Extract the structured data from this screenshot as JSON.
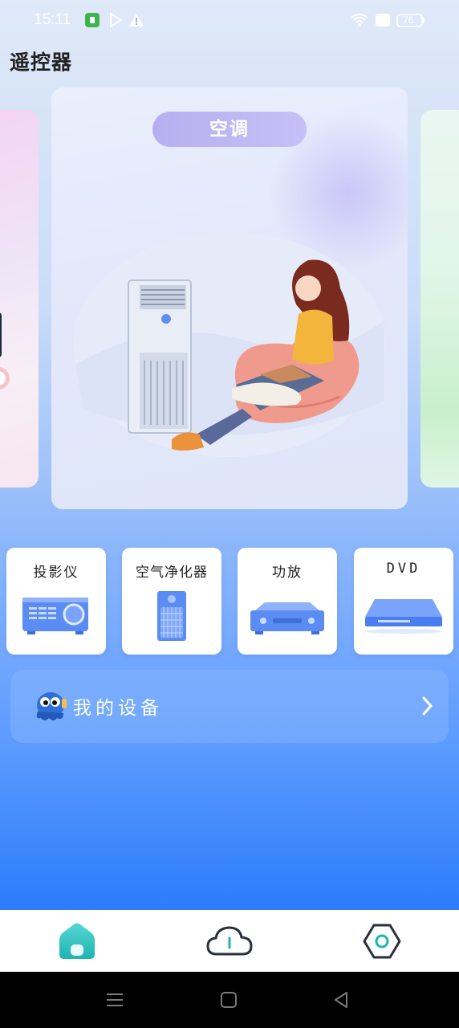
{
  "status_bar": {
    "time": "15:11",
    "battery": "76"
  },
  "header": {
    "title": "遥控器"
  },
  "featured": {
    "title": "空调"
  },
  "devices": [
    {
      "label": "投影仪",
      "icon": "projector-icon"
    },
    {
      "label": "空气净化器",
      "icon": "air-purifier-icon"
    },
    {
      "label": "功放",
      "icon": "amplifier-icon"
    },
    {
      "label": "DVD",
      "icon": "dvd-player-icon"
    }
  ],
  "my_devices": {
    "label": "我的设备"
  },
  "tab_bar": {
    "items": [
      {
        "icon": "home-icon",
        "active": true
      },
      {
        "icon": "cloud-icon",
        "active": false
      },
      {
        "icon": "settings-hexagon-icon",
        "active": false
      }
    ]
  },
  "colors": {
    "accent_teal": "#2fc4c0",
    "brand_blue": "#2a7af8",
    "pill_purple": "#b7aef0"
  }
}
